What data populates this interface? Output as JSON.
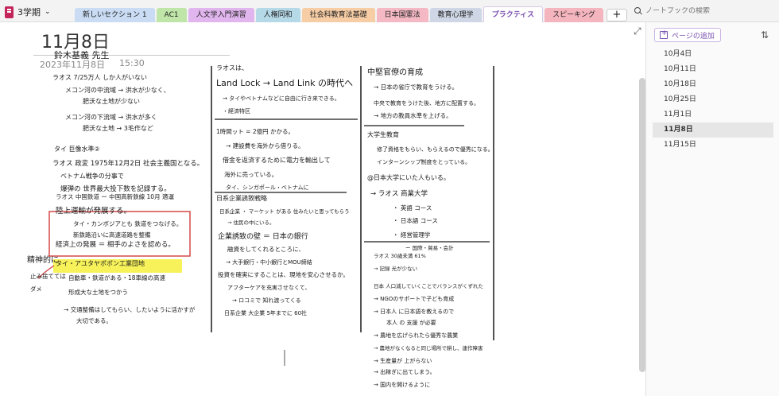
{
  "notebook": {
    "name": "3学期"
  },
  "sections": [
    {
      "label": "新しいセクション 1",
      "color": "#c9dcf3",
      "active": false
    },
    {
      "label": "AC1",
      "color": "#bfe5a8",
      "active": false
    },
    {
      "label": "人文学入門演習",
      "color": "#e1b6ee",
      "active": false
    },
    {
      "label": "人権同和",
      "color": "#b6d9e8",
      "active": false
    },
    {
      "label": "社会科教育法基礎",
      "color": "#f6cda5",
      "active": false
    },
    {
      "label": "日本国憲法",
      "color": "#f4b9c4",
      "active": false
    },
    {
      "label": "教育心理学",
      "color": "#cfd7e6",
      "active": false
    },
    {
      "label": "プラクティス",
      "color": "#ffffff",
      "active": true
    },
    {
      "label": "スピーキング",
      "color": "#f5b5bf",
      "active": false
    }
  ],
  "add_section_label": "+",
  "search": {
    "placeholder": "ノートブックの検索"
  },
  "page": {
    "title": "11月8日",
    "date": "2023年11月8日",
    "time": "15:30"
  },
  "sidebar": {
    "add_page_label": "ページの追加",
    "pages": [
      "10月4日",
      "10月11日",
      "10月18日",
      "10月25日",
      "11月1日",
      "11月8日",
      "11月15日"
    ],
    "selected_index": 5
  },
  "ink": {
    "col1": [
      "鈴木基義 先生",
      "ラオス 7/25万人 しか人がいない",
      "メコン河の中流域 → 洪水が少なく、",
      "肥沃な土地が少ない",
      "メコン河の下流域 → 洪水が多く",
      "肥沃な土地 → 3毛作など",
      "タイ 巨像水準②",
      "ラオス 政変 1975年12月2日 社会主義国となる。",
      "ベトナム戦争の分事で",
      "爆弾の 世界最大投下数を記録する。",
      "ラオス 中国鉄道 ー 中国高新鉄線 10月 適運",
      "陸上運輸が発展する。",
      "タイ・カンボジアとも 鉄道をつなげる。",
      "新鉄路沿いに高速道路を整備",
      "経済上の発展 ＝ 相手のよさを認める。",
      "タイ・アユタヤポポン工業団地",
      "自動車・鉄道がある・18車線の高速",
      "形成大な土地をつかう",
      "→ 交通整備はしてもらい、したいように活かすが",
      "大切である。",
      "精神的に",
      "止み捨てては",
      "ダメ"
    ],
    "col2": [
      "ラオスは、",
      "Land Lock → Land Link の時代へ",
      "→ タイやベトナムなどに自由に行き来できる。",
      "・経済特区",
      "1時間ット = 2億円 かかる。",
      "→ 建設費を海外から借りる。",
      "借金を返済するために電力を輸出して",
      "海外に売っている。",
      "タイ、シンガポール・ベトナムに",
      "日系企業誘致戦略",
      "日系企業 ・ マーケット がある 住みたいと思ってもらう",
      "→ 住民の中にいる。",
      "企業誘致の壁 ＝ 日本の銀行",
      "融資をしてくれるところに、",
      "→ 大手銀行・中小銀行とMOU締結",
      "投資を確実にすることは、現地を安心させるか。",
      "アフターケアを充実させなくて、",
      "→ ロコミで 知れ渡ってくる",
      "日系企業 大企業 5年までに 60社"
    ],
    "col3": [
      "中堅官僚の育成",
      "→ 日本の省庁で教育をうける。",
      "中央で教育をうけた後、地方に配置する。",
      "→ 地方の教員水準を上げる。",
      "大学生教育",
      "修了資格をもらい、もらえるので優秀になる。",
      "インターンシップ制度をとっている。",
      "@日本大学にいた人もいる。",
      "→ ラオス 商業大学",
      "・ 英語 コース",
      "・ 日本語 コース",
      "・ 経営管理学",
      "ー 国際・貿易・会計",
      "ラオス 30歳未満 61%",
      "→ 記録 光が少ない",
      "日本 人口減していくことでバランスがくずれた",
      "→ NGOのサポートで子ども育成",
      "→ 日本人 に日本語を教えるので",
      "本人 の 支援 が必要",
      "→ 農地を広げられたら優秀な農業",
      "→ 農地がなくなると同じ場所で耕し、連作障害",
      "→ 生産量が 上がらない",
      "→ 出稼ぎに出てしまう。",
      "→ 国内を開けるように"
    ]
  }
}
